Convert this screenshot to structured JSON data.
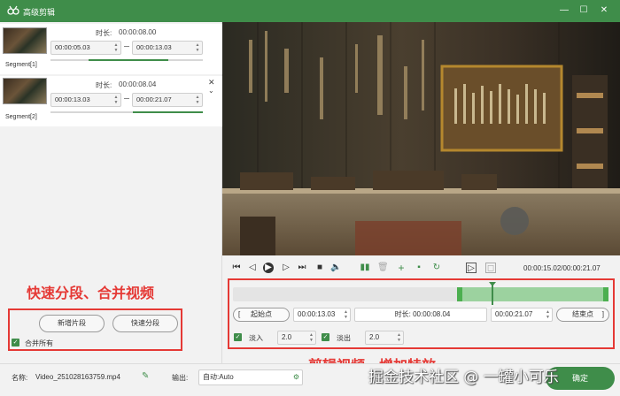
{
  "window": {
    "title": "高级剪辑"
  },
  "segments": [
    {
      "label": "Segment[1]",
      "duration_label": "时长:",
      "duration": "00:00:08.00",
      "start": "00:00:05.03",
      "end": "00:00:13.03"
    },
    {
      "label": "Segment[2]",
      "duration_label": "时长:",
      "duration": "00:00:08.04",
      "start": "00:00:13.03",
      "end": "00:00:21.07"
    }
  ],
  "left_actions": {
    "add_segment": "新增片段",
    "quick_split": "快速分段",
    "merge_all": "合并所有"
  },
  "annotations": {
    "left": "快速分段、合并视频",
    "bottom": "剪辑视频、增加特效"
  },
  "player": {
    "time": "00:00:15.02/00:00:21.07"
  },
  "editor": {
    "start_btn": "起始点",
    "start_val": "00:00:13.03",
    "duration_label": "时长:",
    "duration_val": "00:00:08.04",
    "end_val": "00:00:21.07",
    "end_btn": "结束点",
    "fade_in_label": "淡入",
    "fade_in_val": "2.0",
    "fade_out_label": "淡出",
    "fade_out_val": "2.0"
  },
  "bottom": {
    "name_label": "名称:",
    "name_val": "Video_251028163759.mp4",
    "output_label": "输出:",
    "output_val": "自动:Auto",
    "confirm": "确定"
  },
  "watermark": {
    "text": "掘金技术社区 @ 一罐小可乐"
  },
  "colors": {
    "accent": "#3f8d4a",
    "annotation": "#e53935"
  }
}
